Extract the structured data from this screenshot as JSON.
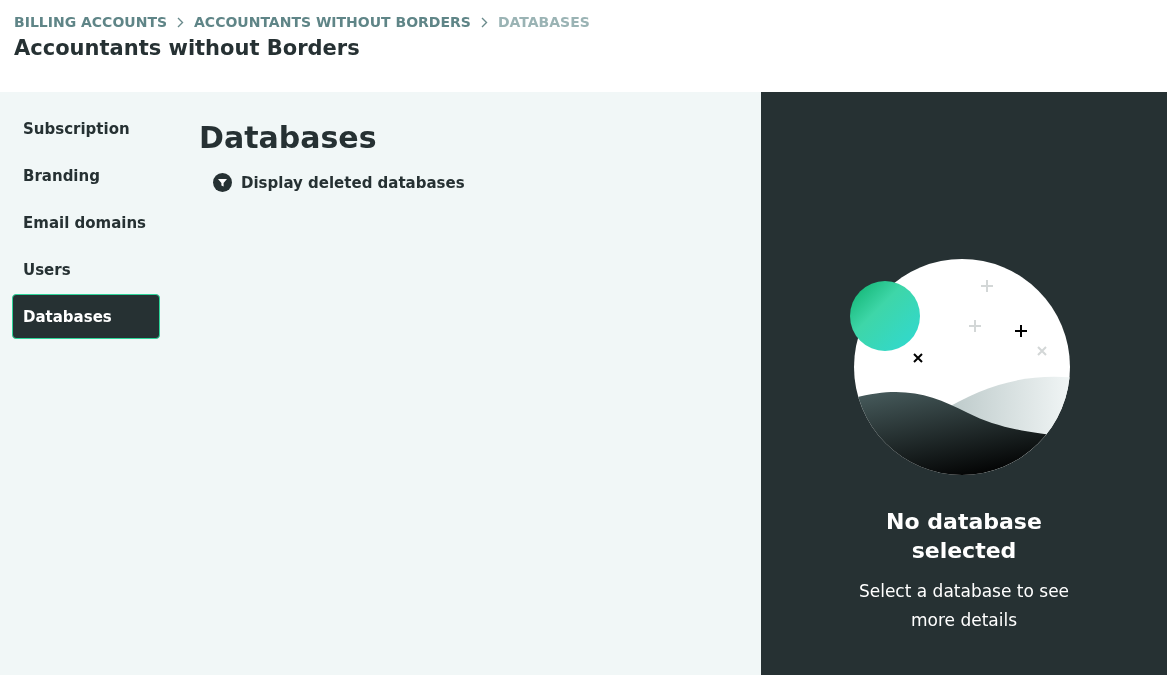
{
  "breadcrumbs": [
    {
      "label": "BILLING ACCOUNTS",
      "current": false
    },
    {
      "label": "ACCOUNTANTS WITHOUT BORDERS",
      "current": false
    },
    {
      "label": "DATABASES",
      "current": true
    }
  ],
  "page_title": "Accountants without Borders",
  "sidebar": {
    "items": [
      {
        "label": "Subscription",
        "selected": false
      },
      {
        "label": "Branding",
        "selected": false
      },
      {
        "label": "Email domains",
        "selected": false
      },
      {
        "label": "Users",
        "selected": false
      },
      {
        "label": "Databases",
        "selected": true
      }
    ]
  },
  "main": {
    "heading": "Databases",
    "filter_label": "Display deleted databases"
  },
  "detail_panel": {
    "title": "No database selected",
    "message": "Select a database to see more details"
  }
}
